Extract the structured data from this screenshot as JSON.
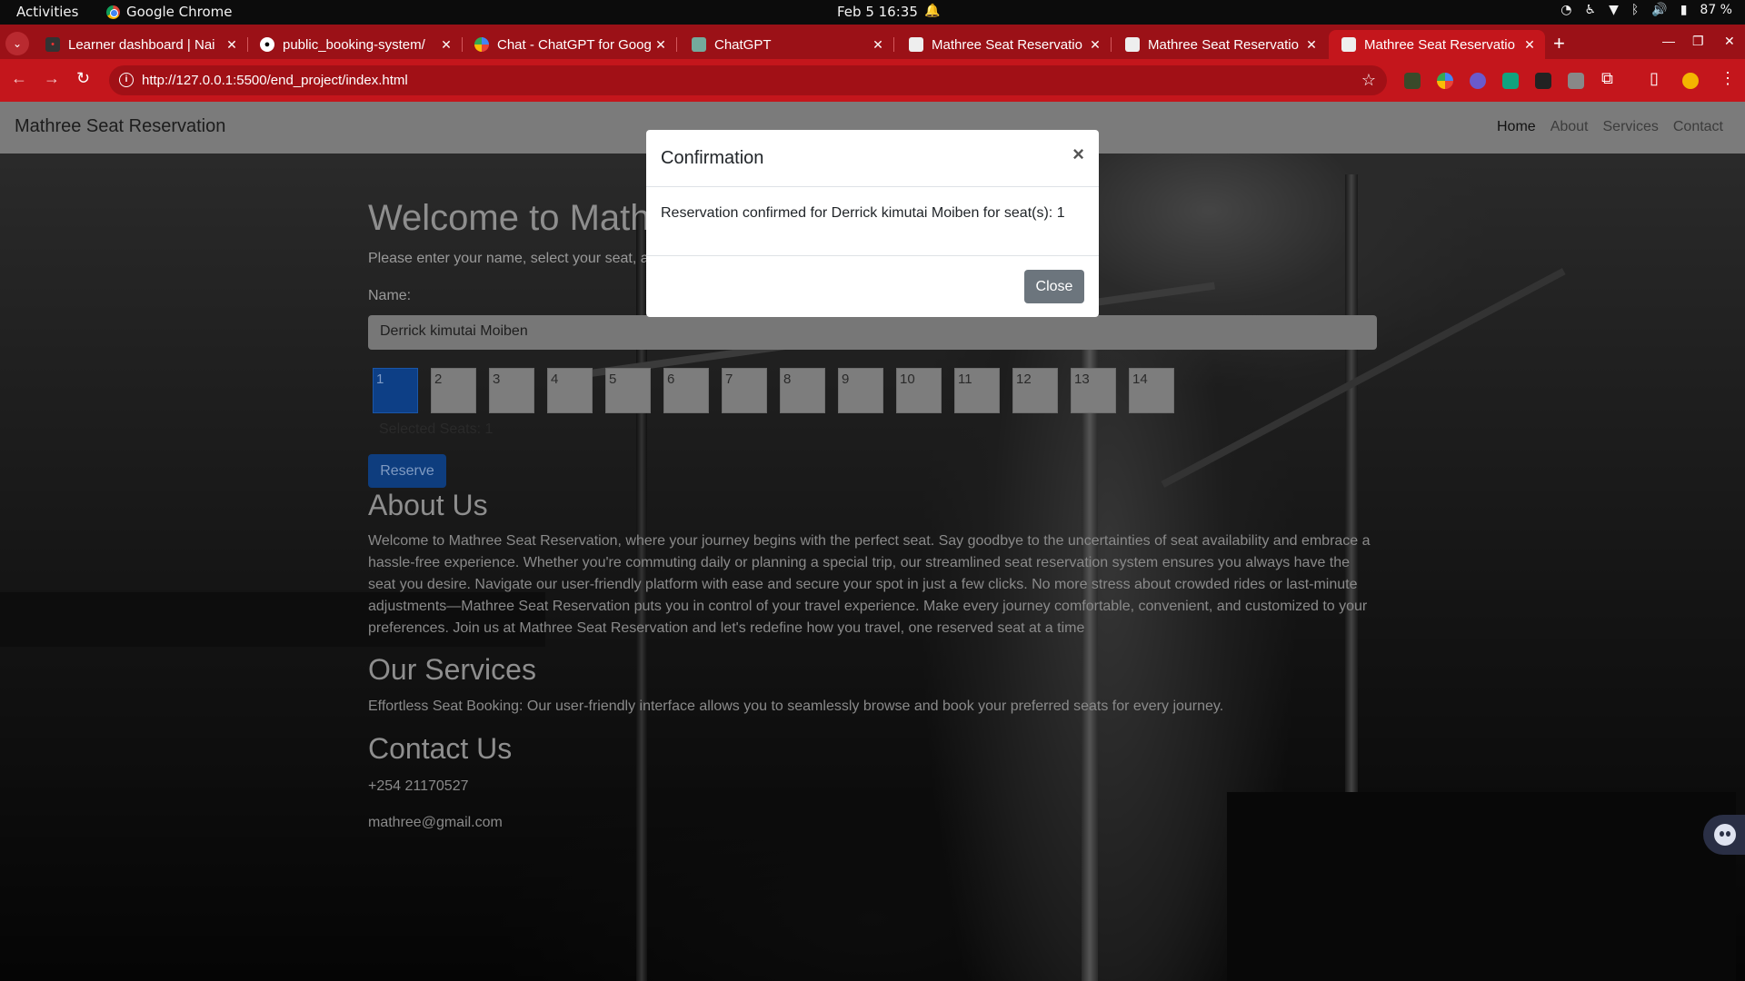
{
  "os": {
    "activities": "Activities",
    "app_name": "Google Chrome",
    "clock": "Feb 5  16:35",
    "battery": "87 %"
  },
  "tabs": [
    {
      "title": "Learner dashboard | Nai",
      "icon": "learner-icon"
    },
    {
      "title": "public_booking-system/",
      "icon": "github-icon"
    },
    {
      "title": "Chat - ChatGPT for Goog",
      "icon": "google-icon"
    },
    {
      "title": "ChatGPT",
      "icon": "chatgpt-icon"
    },
    {
      "title": "Mathree Seat Reservatio",
      "icon": "page-icon"
    },
    {
      "title": "Mathree Seat Reservatio",
      "icon": "page-icon"
    },
    {
      "title": "Mathree Seat Reservatio",
      "icon": "page-icon"
    }
  ],
  "address_bar": {
    "url": "http://127.0.0.1:5500/end_project/index.html"
  },
  "site": {
    "brand": "Mathree Seat Reservation",
    "nav": {
      "home": "Home",
      "about": "About",
      "services": "Services",
      "contact": "Contact"
    },
    "welcome_heading": "Welcome to Math",
    "intro": "Please enter your name, select your seat, a",
    "name_label": "Name:",
    "name_value": "Derrick kimutai Moiben",
    "seats": [
      "1",
      "2",
      "3",
      "4",
      "5",
      "6",
      "7",
      "8",
      "9",
      "10",
      "11",
      "12",
      "13",
      "14"
    ],
    "selected_seat": "1",
    "selected_text": "Selected Seats: 1",
    "reserve_label": "Reserve",
    "about_heading": "About Us",
    "about_text": "Welcome to Mathree Seat Reservation, where your journey begins with the perfect seat. Say goodbye to the uncertainties of seat availability and embrace a hassle-free experience. Whether you're commuting daily or planning a special trip, our streamlined seat reservation system ensures you always have the seat you desire. Navigate our user-friendly platform with ease and secure your spot in just a few clicks. No more stress about crowded rides or last-minute adjustments—Mathree Seat Reservation puts you in control of your travel experience. Make every journey comfortable, convenient, and customized to your preferences. Join us at Mathree Seat Reservation and let's redefine how you travel, one reserved seat at a time",
    "services_heading": "Our Services",
    "services_text": "Effortless Seat Booking: Our user-friendly interface allows you to seamlessly browse and book your preferred seats for every journey.",
    "contact_heading": "Contact Us",
    "phone": "+254 21170527",
    "email": "mathree@gmail.com"
  },
  "modal": {
    "title": "Confirmation",
    "close_x": "×",
    "message": "Reservation confirmed for Derrick kimutai Moiben for seat(s): 1",
    "close_label": "Close"
  }
}
